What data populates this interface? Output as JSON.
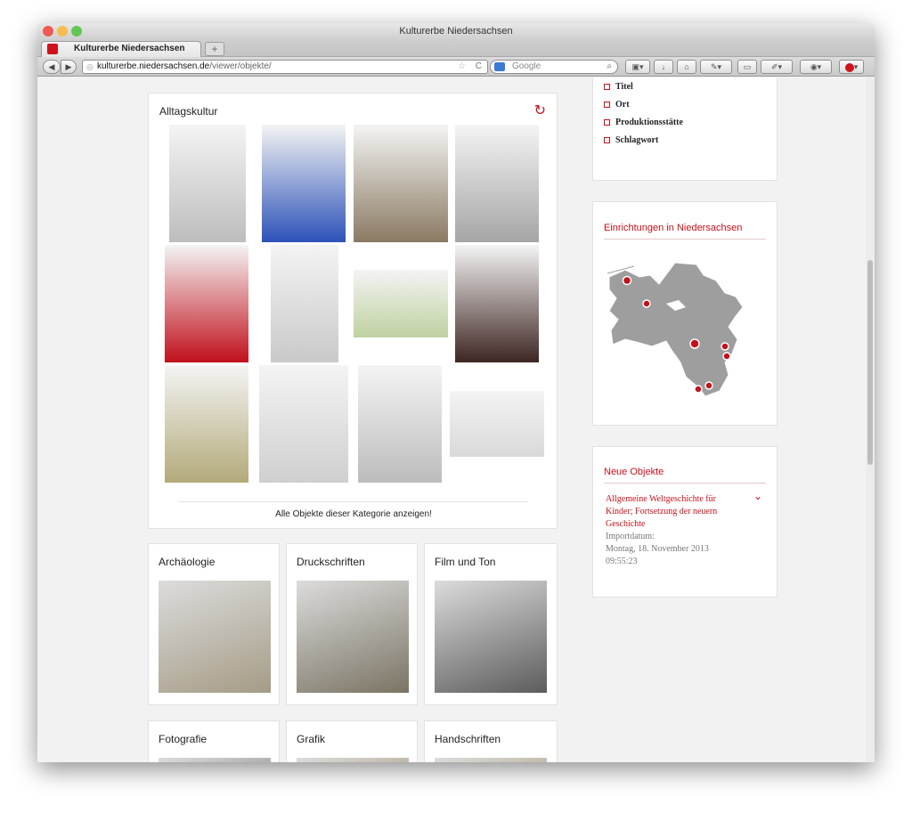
{
  "window": {
    "title": "Kulturerbe Niedersachsen"
  },
  "tab": {
    "label": "Kulturerbe Niedersachsen",
    "new_tab": "+"
  },
  "navbar": {
    "url_host": "kulturerbe.niedersachsen.de",
    "url_path": "/viewer/objekte/",
    "url_prefix": "",
    "search_placeholder": "Google"
  },
  "featured": {
    "title": "Alltagskultur",
    "show_all": "Alle Objekte dieser Kategorie anzeigen!",
    "thumbs": [
      {
        "name": "clear-glass-bottle",
        "color": "#bdbdbd"
      },
      {
        "name": "blue-glass-tumbler",
        "color": "#2c52b8"
      },
      {
        "name": "historical-painting",
        "color": "#8a7a62"
      },
      {
        "name": "cut-glass-goblet",
        "color": "#a5a5a5"
      },
      {
        "name": "red-glass-vase",
        "color": "#c0101c"
      },
      {
        "name": "champagne-flute",
        "color": "#c9c9c9"
      },
      {
        "name": "green-glass-bowl",
        "color": "#bfd1a0"
      },
      {
        "name": "dark-glass-bottle",
        "color": "#3d2622"
      },
      {
        "name": "amber-glass-cup",
        "color": "#b3aa7a"
      },
      {
        "name": "glass-beer-mug",
        "color": "#cfcfcf"
      },
      {
        "name": "glass-carafe",
        "color": "#bcbcbc"
      },
      {
        "name": "wine-glass-set",
        "color": "#d9d9d9"
      }
    ]
  },
  "categories": [
    {
      "title": "Archäologie",
      "color": "#a59c86"
    },
    {
      "title": "Druckschriften",
      "color": "#7a7463"
    },
    {
      "title": "Film und Ton",
      "color": "#5c5c5c"
    },
    {
      "title": "Fotografie",
      "color": "#9a9a9a"
    },
    {
      "title": "Grafik",
      "color": "#b1a891"
    },
    {
      "title": "Handschriften",
      "color": "#b4ad94"
    }
  ],
  "sidebar": {
    "filters": [
      "Titel",
      "Ort",
      "Produktionsstätte",
      "Schlagwort"
    ],
    "map_title": "Einrichtungen in Niedersachsen",
    "new_objects_title": "Neue Objekte",
    "new_object": {
      "title": "Allgemeine Weltgeschichte für Kinder; Fortsetzung der neuern Geschichte",
      "import_label": "Importdatum:",
      "import_date": "Montag, 18. November 2013 09:55:23"
    }
  },
  "colors": {
    "accent": "#c4121a",
    "card_bg": "#ffffff",
    "page_bg": "#f2f2f2"
  }
}
